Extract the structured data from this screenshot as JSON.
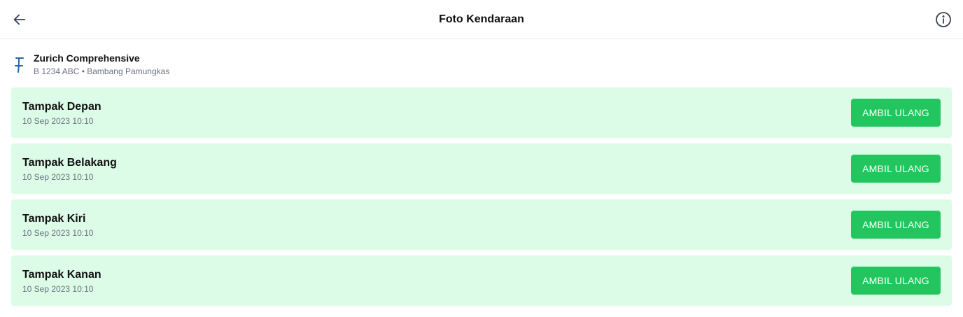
{
  "header": {
    "title": "Foto Kendaraan",
    "back_icon": "arrow-left-icon",
    "info_icon": "info-circle-icon"
  },
  "policy": {
    "logo_icon": "zurich-logo-icon",
    "name": "Zurich Comprehensive",
    "subtitle": "B 1234 ABC • Bambang Pamungkas"
  },
  "photos": [
    {
      "label": "Tampak Depan",
      "timestamp": "10 Sep 2023 10:10",
      "button": "AMBIL ULANG"
    },
    {
      "label": "Tampak Belakang",
      "timestamp": "10 Sep 2023 10:10",
      "button": "AMBIL ULANG"
    },
    {
      "label": "Tampak Kiri",
      "timestamp": "10 Sep 2023 10:10",
      "button": "AMBIL ULANG"
    },
    {
      "label": "Tampak Kanan",
      "timestamp": "10 Sep 2023 10:10",
      "button": "AMBIL ULANG"
    }
  ],
  "colors": {
    "card_background": "#dcfce7",
    "button_background": "#22c55e",
    "logo_blue": "#2167ae"
  }
}
